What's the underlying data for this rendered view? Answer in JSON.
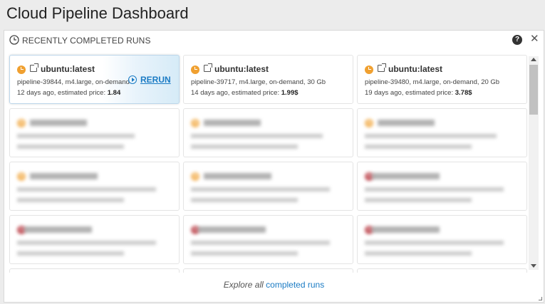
{
  "app": {
    "title": "Cloud Pipeline Dashboard"
  },
  "panel": {
    "title": "RECENTLY COMPLETED RUNS",
    "help_icon": "?",
    "close_icon": "✕"
  },
  "runs": [
    {
      "name": "ubuntu:latest",
      "line1": "pipeline-39844, m4.large, on-demand",
      "line2_prefix": "12 days ago, estimated price: ",
      "price": "1.84",
      "status": "orange"
    },
    {
      "name": "ubuntu:latest",
      "line1": "pipeline-39717, m4.large, on-demand, 30 Gb",
      "line2_prefix": "14 days ago, estimated price: ",
      "price": "1.99$",
      "status": "orange"
    },
    {
      "name": "ubuntu:latest",
      "line1": "pipeline-39480, m4.large, on-demand, 20 Gb",
      "line2_prefix": "19 days ago, estimated price: ",
      "price": "3.78$",
      "status": "orange"
    }
  ],
  "rerun": {
    "label": "RERUN"
  },
  "footer": {
    "text": "Explore all ",
    "link": "completed runs"
  },
  "colors": {
    "accent": "#1a7bc4",
    "status_orange": "#f0a030",
    "status_red": "#b0202a"
  }
}
